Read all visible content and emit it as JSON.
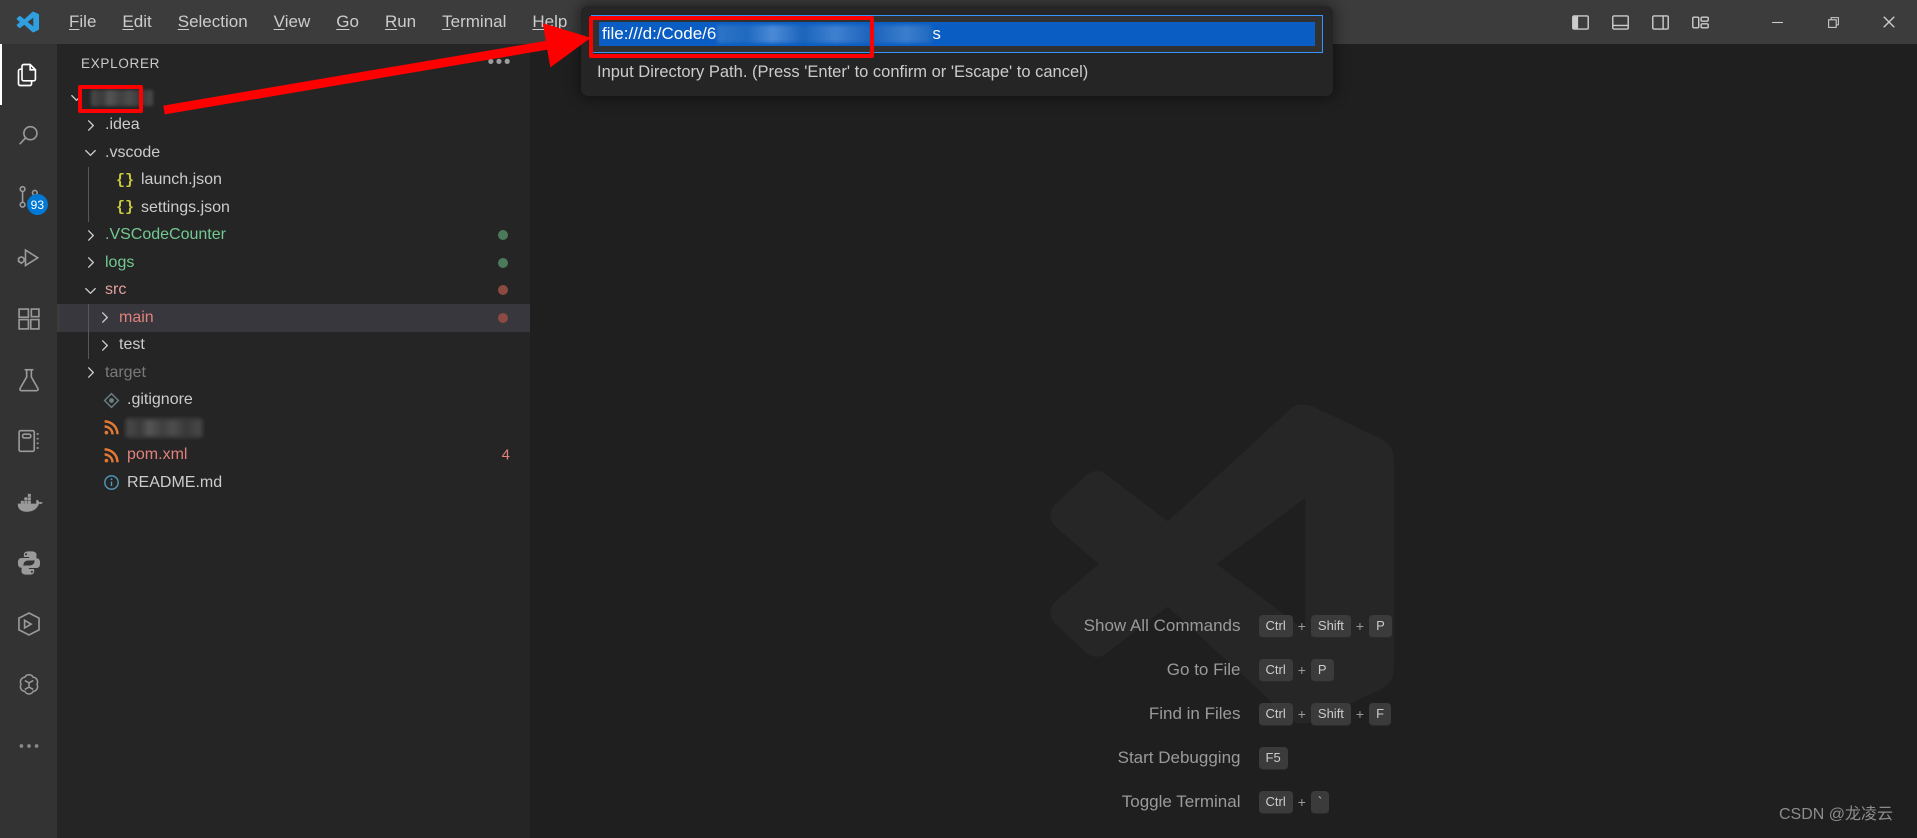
{
  "titlebar": {
    "logo_icon": "vscode-logo-icon",
    "menus": [
      {
        "label": "File",
        "mnemonic": "F",
        "rest": "ile"
      },
      {
        "label": "Edit",
        "mnemonic": "E",
        "rest": "dit"
      },
      {
        "label": "Selection",
        "mnemonic": "S",
        "rest": "election"
      },
      {
        "label": "View",
        "mnemonic": "V",
        "rest": "iew"
      },
      {
        "label": "Go",
        "mnemonic": "G",
        "rest": "o"
      },
      {
        "label": "Run",
        "mnemonic": "R",
        "rest": "un"
      },
      {
        "label": "Terminal",
        "mnemonic": "T",
        "rest": "erminal"
      },
      {
        "label": "Help",
        "mnemonic": "H",
        "rest": "elp"
      }
    ],
    "layout_buttons": [
      {
        "name": "toggle-primary-sidebar-icon",
        "title": "Toggle Primary Side Bar"
      },
      {
        "name": "toggle-panel-icon",
        "title": "Toggle Panel"
      },
      {
        "name": "toggle-secondary-sidebar-icon",
        "title": "Toggle Secondary Side Bar"
      },
      {
        "name": "customize-layout-icon",
        "title": "Customize Layout"
      }
    ],
    "window_buttons": [
      {
        "name": "minimize-icon",
        "title": "Minimize"
      },
      {
        "name": "restore-icon",
        "title": "Restore"
      },
      {
        "name": "close-icon",
        "title": "Close"
      }
    ]
  },
  "activitybar": {
    "items": [
      {
        "name": "explorer",
        "icon": "files-icon",
        "title": "Explorer",
        "active": true,
        "badge": ""
      },
      {
        "name": "search",
        "icon": "search-icon",
        "title": "Search",
        "active": false,
        "badge": ""
      },
      {
        "name": "source-control",
        "icon": "source-control-icon",
        "title": "Source Control",
        "active": false,
        "badge": "93"
      },
      {
        "name": "run-and-debug",
        "icon": "run-debug-icon",
        "title": "Run and Debug",
        "active": false,
        "badge": ""
      },
      {
        "name": "extensions",
        "icon": "extensions-icon",
        "title": "Extensions",
        "active": false,
        "badge": ""
      },
      {
        "name": "testing",
        "icon": "beaker-icon",
        "title": "Testing",
        "active": false,
        "badge": ""
      },
      {
        "name": "notebook",
        "icon": "notebook-icon",
        "title": "Jupyter",
        "active": false,
        "badge": ""
      },
      {
        "name": "docker",
        "icon": "docker-whale-icon",
        "title": "Docker",
        "active": false,
        "badge": ""
      },
      {
        "name": "python",
        "icon": "python-icon",
        "title": "Python",
        "active": false,
        "badge": ""
      },
      {
        "name": "cube",
        "icon": "cube-icon",
        "title": "Package Explorer",
        "active": false,
        "badge": ""
      },
      {
        "name": "openai",
        "icon": "openai-icon",
        "title": "ChatGPT",
        "active": false,
        "badge": ""
      },
      {
        "name": "additional-views",
        "icon": "ellipsis-icon",
        "title": "Additional Views",
        "active": false,
        "badge": ""
      }
    ]
  },
  "sidebar": {
    "title": "EXPLORER",
    "more_actions_label": "•••",
    "tree": [
      {
        "label": "",
        "redacted": true,
        "redact_width": 62,
        "indent": 0,
        "twisty": "down",
        "kind": "folder-root",
        "color": "#cccccc",
        "deco": "",
        "deco_color": "",
        "selected": false,
        "bold": true
      },
      {
        "label": ".idea",
        "redacted": false,
        "indent": 1,
        "twisty": "right",
        "kind": "folder",
        "color": "#cccccc",
        "deco": "",
        "deco_color": "",
        "selected": false
      },
      {
        "label": ".vscode",
        "redacted": false,
        "indent": 1,
        "twisty": "down",
        "kind": "folder",
        "color": "#cccccc",
        "deco": "",
        "deco_color": "",
        "selected": false
      },
      {
        "label": "launch.json",
        "redacted": false,
        "indent": 2,
        "twisty": "none",
        "kind": "json",
        "color": "#cccccc",
        "deco": "",
        "deco_color": "",
        "selected": false
      },
      {
        "label": "settings.json",
        "redacted": false,
        "indent": 2,
        "twisty": "none",
        "kind": "json",
        "color": "#cccccc",
        "deco": "",
        "deco_color": "",
        "selected": false
      },
      {
        "label": ".VSCodeCounter",
        "redacted": false,
        "indent": 1,
        "twisty": "right",
        "kind": "folder",
        "color": "#73c991",
        "deco": "dot",
        "deco_color": "#4b7a5a",
        "selected": false
      },
      {
        "label": "logs",
        "redacted": false,
        "indent": 1,
        "twisty": "right",
        "kind": "folder",
        "color": "#73c991",
        "deco": "dot",
        "deco_color": "#4b7a5a",
        "selected": false
      },
      {
        "label": "src",
        "redacted": false,
        "indent": 1,
        "twisty": "down",
        "kind": "folder",
        "color": "#e2a0a0",
        "deco": "dot",
        "deco_color": "#8d4a43",
        "selected": false
      },
      {
        "label": "main",
        "redacted": false,
        "indent": 2,
        "twisty": "right",
        "kind": "folder",
        "color": "#e2817b",
        "deco": "dot",
        "deco_color": "#8d4a43",
        "selected": true
      },
      {
        "label": "test",
        "redacted": false,
        "indent": 2,
        "twisty": "right",
        "kind": "folder",
        "color": "#cccccc",
        "deco": "",
        "deco_color": "",
        "selected": false
      },
      {
        "label": "target",
        "redacted": false,
        "indent": 1,
        "twisty": "right",
        "kind": "folder",
        "color": "#7a7a7a",
        "deco": "",
        "deco_color": "",
        "selected": false
      },
      {
        "label": ".gitignore",
        "redacted": false,
        "indent": 1,
        "twisty": "none",
        "kind": "git",
        "color": "#cccccc",
        "deco": "",
        "deco_color": "",
        "selected": false
      },
      {
        "label": "",
        "redacted": true,
        "redact_width": 74,
        "indent": 1,
        "twisty": "none",
        "kind": "xml",
        "color": "#cccccc",
        "deco": "",
        "deco_color": "",
        "selected": false,
        "focused": true
      },
      {
        "label": "pom.xml",
        "redacted": false,
        "indent": 1,
        "twisty": "none",
        "kind": "xml",
        "color": "#e2817b",
        "deco": "4",
        "deco_color": "#e2817b",
        "selected": false
      },
      {
        "label": "README.md",
        "redacted": false,
        "indent": 1,
        "twisty": "none",
        "kind": "info",
        "color": "#cccccc",
        "deco": "",
        "deco_color": "",
        "selected": false
      }
    ]
  },
  "quick_input": {
    "value_visible": "file:///d:/Code/6",
    "value_redacted_suffix": "s",
    "description": "Input Directory Path. (Press 'Enter' to confirm or 'Escape' to cancel)",
    "border_color": "#3794ff",
    "selection_color": "#0a5dc2"
  },
  "editor_watermark": {
    "logo_icon": "vscode-logo-watermark",
    "shortcuts": [
      {
        "label": "Show All Commands",
        "keys": [
          "Ctrl",
          "Shift",
          "P"
        ]
      },
      {
        "label": "Go to File",
        "keys": [
          "Ctrl",
          "P"
        ]
      },
      {
        "label": "Find in Files",
        "keys": [
          "Ctrl",
          "Shift",
          "F"
        ]
      },
      {
        "label": "Start Debugging",
        "keys": [
          "F5"
        ]
      },
      {
        "label": "Toggle Terminal",
        "keys": [
          "Ctrl",
          "`"
        ]
      }
    ],
    "separator": "+"
  },
  "annotations": {
    "color": "#fe0000",
    "box_root_folder": "red-rect-around-root-folder",
    "box_input": "red-rect-around-path-input",
    "arrow": "red-arrow-root-to-input"
  },
  "footer": {
    "credit": "CSDN @龙凌云"
  }
}
